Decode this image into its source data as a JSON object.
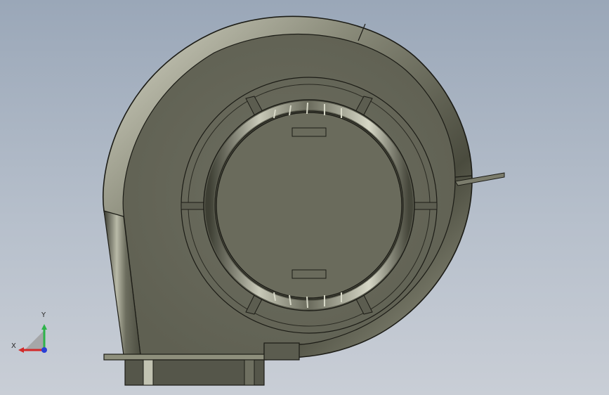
{
  "viewport": {
    "background_top": "#9aa7b8",
    "background_bottom": "#c9ced6",
    "part_color": "#6e6f60",
    "part_dark": "#3e3f34",
    "edge_color": "#1c1c16"
  },
  "model": {
    "part": "centrifugal-blower-housing"
  },
  "triad": {
    "x_label": "X",
    "y_label": "Y",
    "x_color": "#d22a2a",
    "y_color": "#2db34a",
    "z_color": "#2a3fd6"
  }
}
